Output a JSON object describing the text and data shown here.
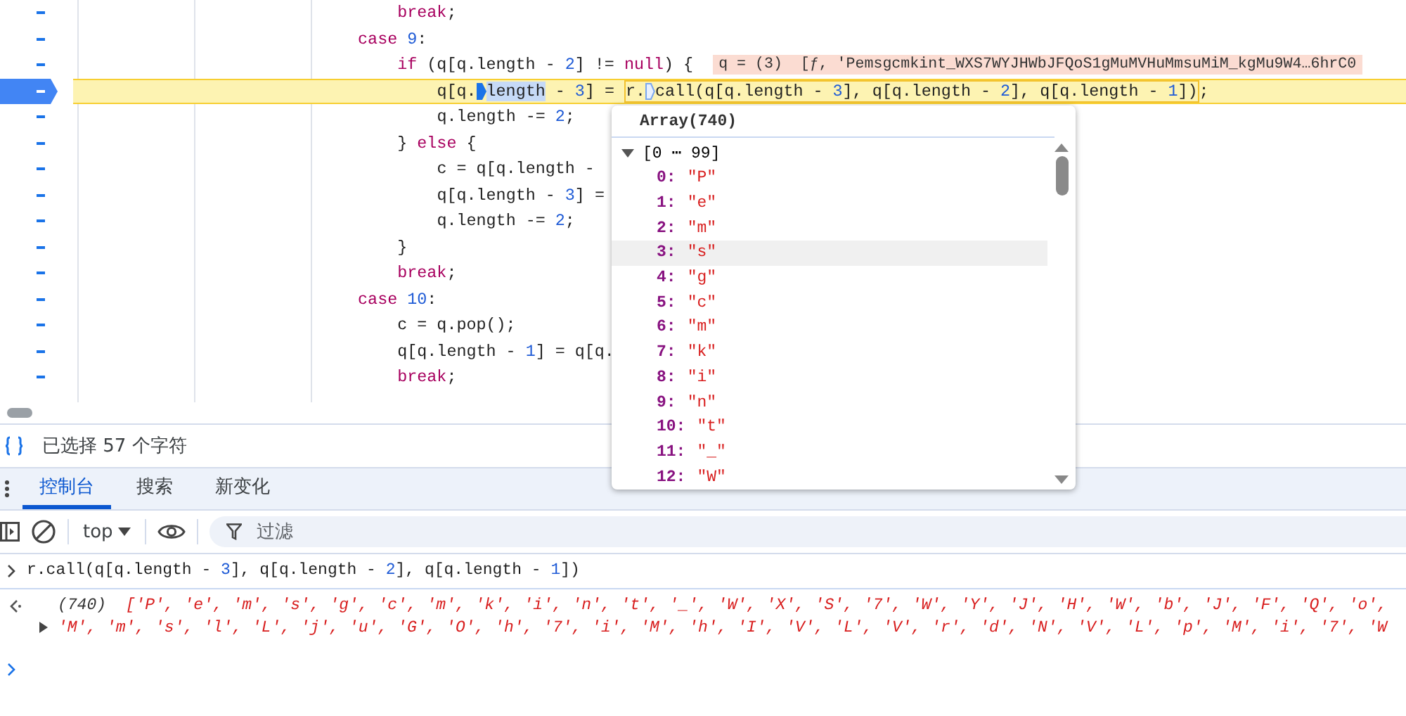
{
  "code_lines": [
    {
      "current": false,
      "runs": [
        {
          "kind": "text",
          "tokens": [
            {
              "kind": "keyword",
              "text": "break"
            },
            {
              "kind": "plain",
              "text": ";"
            }
          ]
        }
      ]
    },
    {
      "current": false,
      "runs": [
        {
          "kind": "text",
          "tokens": [
            {
              "kind": "keyword",
              "text": "case "
            },
            {
              "kind": "number",
              "text": "9"
            },
            {
              "kind": "plain",
              "text": ":"
            }
          ]
        }
      ]
    },
    {
      "current": false,
      "runs": [
        {
          "kind": "text",
          "tokens": [
            {
              "kind": "keyword",
              "text": "if"
            },
            {
              "kind": "plain",
              "text": " (q[q.length - "
            },
            {
              "kind": "number",
              "text": "2"
            },
            {
              "kind": "plain",
              "text": "] != "
            },
            {
              "kind": "keyword",
              "text": "null"
            },
            {
              "kind": "plain",
              "text": ") {"
            }
          ]
        },
        {
          "kind": "inline_value",
          "text": "q = (3)  [ƒ, 'Pemsgcmkint_WXS7WYJHWbJFQoS1gMuMVHuMmsuMiM_kgMu9W4…6hrC0"
        }
      ]
    },
    {
      "current": true,
      "runs": [
        {
          "kind": "text",
          "tokens": [
            {
              "kind": "plain",
              "text": "q[q."
            }
          ]
        },
        {
          "kind": "breakpoint",
          "active": true
        },
        {
          "kind": "selection",
          "tokens": [
            {
              "kind": "plain",
              "text": "length"
            }
          ]
        },
        {
          "kind": "text",
          "tokens": [
            {
              "kind": "plain",
              "text": " - "
            },
            {
              "kind": "number",
              "text": "3"
            },
            {
              "kind": "plain",
              "text": "] = "
            }
          ]
        },
        {
          "kind": "box",
          "runs": [
            {
              "kind": "text",
              "tokens": [
                {
                  "kind": "plain",
                  "text": "r."
                }
              ]
            },
            {
              "kind": "breakpoint",
              "active": false
            },
            {
              "kind": "text",
              "tokens": [
                {
                  "kind": "plain",
                  "text": "call(q[q.length - "
                },
                {
                  "kind": "number",
                  "text": "3"
                },
                {
                  "kind": "plain",
                  "text": "], q[q.length - "
                },
                {
                  "kind": "number",
                  "text": "2"
                },
                {
                  "kind": "plain",
                  "text": "], q[q.length - "
                },
                {
                  "kind": "number",
                  "text": "1"
                },
                {
                  "kind": "plain",
                  "text": "])"
                }
              ]
            }
          ]
        },
        {
          "kind": "text",
          "tokens": [
            {
              "kind": "plain",
              "text": ";"
            }
          ]
        }
      ]
    },
    {
      "current": false,
      "runs": [
        {
          "kind": "text",
          "tokens": [
            {
              "kind": "plain",
              "text": "q.length -= "
            },
            {
              "kind": "number",
              "text": "2"
            },
            {
              "kind": "plain",
              "text": ";"
            }
          ]
        }
      ]
    },
    {
      "current": false,
      "runs": [
        {
          "kind": "text",
          "tokens": [
            {
              "kind": "plain",
              "text": "} "
            },
            {
              "kind": "keyword",
              "text": "else"
            },
            {
              "kind": "plain",
              "text": " {"
            }
          ]
        }
      ]
    },
    {
      "current": false,
      "runs": [
        {
          "kind": "text",
          "tokens": [
            {
              "kind": "plain",
              "text": "c = q[q.length -"
            }
          ]
        }
      ]
    },
    {
      "current": false,
      "runs": [
        {
          "kind": "text",
          "tokens": [
            {
              "kind": "plain",
              "text": "q[q.length - "
            },
            {
              "kind": "number",
              "text": "3"
            },
            {
              "kind": "plain",
              "text": "] ="
            }
          ]
        }
      ]
    },
    {
      "current": false,
      "runs": [
        {
          "kind": "text",
          "tokens": [
            {
              "kind": "plain",
              "text": "q.length -= "
            },
            {
              "kind": "number",
              "text": "2"
            },
            {
              "kind": "plain",
              "text": ";"
            }
          ]
        }
      ]
    },
    {
      "current": false,
      "runs": [
        {
          "kind": "text",
          "tokens": [
            {
              "kind": "plain",
              "text": "}"
            }
          ]
        }
      ]
    },
    {
      "current": false,
      "runs": [
        {
          "kind": "text",
          "tokens": [
            {
              "kind": "keyword",
              "text": "break"
            },
            {
              "kind": "plain",
              "text": ";"
            }
          ]
        }
      ]
    },
    {
      "current": false,
      "runs": [
        {
          "kind": "text",
          "tokens": [
            {
              "kind": "keyword",
              "text": "case "
            },
            {
              "kind": "number",
              "text": "10"
            },
            {
              "kind": "plain",
              "text": ":"
            }
          ]
        }
      ]
    },
    {
      "current": false,
      "runs": [
        {
          "kind": "text",
          "tokens": [
            {
              "kind": "plain",
              "text": "c = q.pop();"
            }
          ]
        }
      ]
    },
    {
      "current": false,
      "runs": [
        {
          "kind": "text",
          "tokens": [
            {
              "kind": "plain",
              "text": "q[q.length - "
            },
            {
              "kind": "number",
              "text": "1"
            },
            {
              "kind": "plain",
              "text": "] = q[q."
            }
          ]
        }
      ]
    },
    {
      "current": false,
      "runs": [
        {
          "kind": "text",
          "tokens": [
            {
              "kind": "keyword",
              "text": "break"
            },
            {
              "kind": "plain",
              "text": ";"
            }
          ]
        }
      ]
    }
  ],
  "popover": {
    "title": "Array(740)",
    "group": {
      "label": "[0 ⋯ 99]",
      "expanded": true
    },
    "items": [
      {
        "index": "0:",
        "value": "\"P\"",
        "hovered": false
      },
      {
        "index": "1:",
        "value": "\"e\"",
        "hovered": false
      },
      {
        "index": "2:",
        "value": "\"m\"",
        "hovered": false
      },
      {
        "index": "3:",
        "value": "\"s\"",
        "hovered": true
      },
      {
        "index": "4:",
        "value": "\"g\"",
        "hovered": false
      },
      {
        "index": "5:",
        "value": "\"c\"",
        "hovered": false
      },
      {
        "index": "6:",
        "value": "\"m\"",
        "hovered": false
      },
      {
        "index": "7:",
        "value": "\"k\"",
        "hovered": false
      },
      {
        "index": "8:",
        "value": "\"i\"",
        "hovered": false
      },
      {
        "index": "9:",
        "value": "\"n\"",
        "hovered": false
      },
      {
        "index": "10:",
        "value": "\"t\"",
        "hovered": false
      },
      {
        "index": "11:",
        "value": "\"_\"",
        "hovered": false
      },
      {
        "index": "12:",
        "value": "\"W\"",
        "hovered": false
      }
    ]
  },
  "status_bar": {
    "text": "已选择 57 个字符"
  },
  "tabs": [
    {
      "label": "控制台",
      "selected": true
    },
    {
      "label": "搜索",
      "selected": false
    },
    {
      "label": "新变化",
      "selected": false
    }
  ],
  "toolbar": {
    "context": "top",
    "filter": {
      "placeholder": "过滤"
    }
  },
  "console": {
    "input": [
      {
        "kind": "plain",
        "text": "r.call(q[q.length - "
      },
      {
        "kind": "number",
        "text": "3"
      },
      {
        "kind": "plain",
        "text": "], q[q.length - "
      },
      {
        "kind": "number",
        "text": "2"
      },
      {
        "kind": "plain",
        "text": "], q[q.length - "
      },
      {
        "kind": "number",
        "text": "1"
      },
      {
        "kind": "plain",
        "text": "])"
      }
    ],
    "result": {
      "count": "(740)",
      "expanded": false,
      "lines": [
        "['P', 'e', 'm', 's', 'g', 'c', 'm', 'k', 'i', 'n', 't', '_', 'W', 'X', 'S', '7', 'W', 'Y', 'J', 'H', 'W', 'b', 'J', 'F', 'Q', 'o',",
        "'M', 'm', 's', 'l', 'L', 'j', 'u', 'G', 'O', 'h', '7', 'i', 'M', 'h', 'I', 'V', 'L', 'V', 'r', 'd', 'N', 'V', 'L', 'p', 'M', 'i', '7', 'W"
      ]
    }
  }
}
